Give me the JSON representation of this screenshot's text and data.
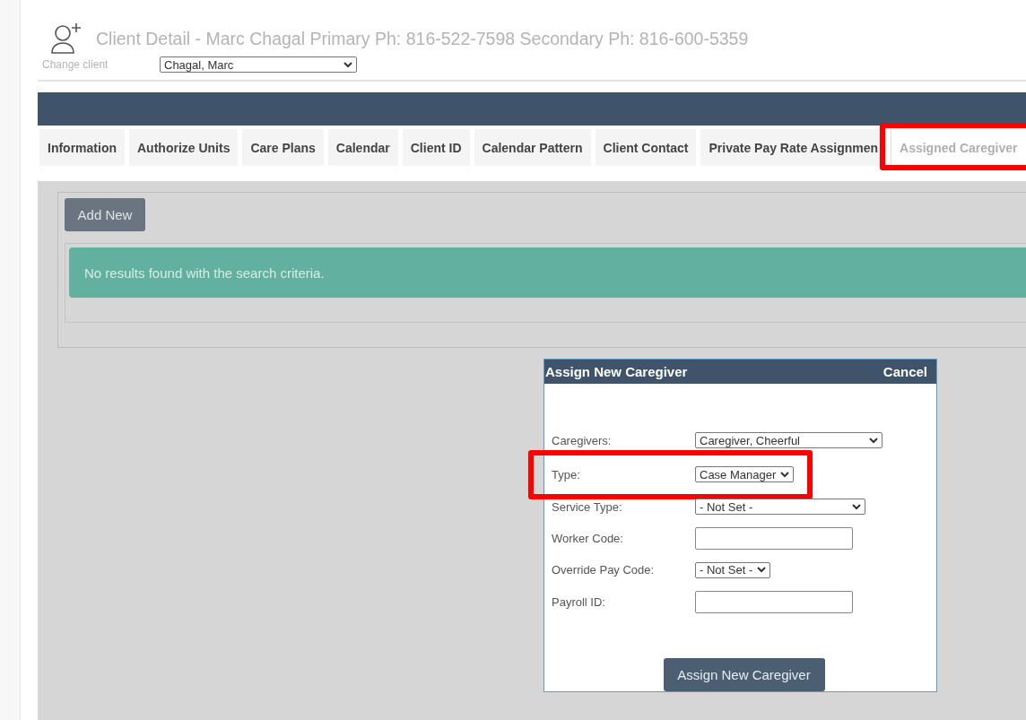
{
  "header": {
    "title": "Client Detail - Marc Chagal Primary Ph: 816-522-7598 Secondary Ph: 816-600-5359",
    "change_client_label": "Change client",
    "client_select": {
      "value": "Chagal, Marc"
    }
  },
  "tabs": [
    {
      "label": "Information",
      "selected": false
    },
    {
      "label": "Authorize Units",
      "selected": false
    },
    {
      "label": "Care Plans",
      "selected": false
    },
    {
      "label": "Calendar",
      "selected": false
    },
    {
      "label": "Client ID",
      "selected": false
    },
    {
      "label": "Calendar Pattern",
      "selected": false
    },
    {
      "label": "Client Contact",
      "selected": false
    },
    {
      "label": "Private Pay Rate Assignmen",
      "selected": false
    },
    {
      "label": "Assigned Caregiver",
      "selected": true,
      "highlighted": true
    }
  ],
  "add_button": "Add New",
  "alert": "No results found with the search criteria.",
  "dialog": {
    "title": "Assign New Caregiver",
    "cancel": "Cancel",
    "fields": [
      {
        "label": "Caregivers:",
        "kind": "select",
        "value": "Caregiver, Cheerful"
      },
      {
        "label": "Type:",
        "kind": "select",
        "value": "Case Manager",
        "highlighted": true
      },
      {
        "label": "Service Type:",
        "kind": "select",
        "value": "- Not Set -"
      },
      {
        "label": "Worker Code:",
        "kind": "text"
      },
      {
        "label": "Override Pay Code:",
        "kind": "select",
        "value": "- Not Set -"
      },
      {
        "label": "Payroll ID:",
        "kind": "text"
      }
    ],
    "submit": "Assign New Caregiver"
  }
}
